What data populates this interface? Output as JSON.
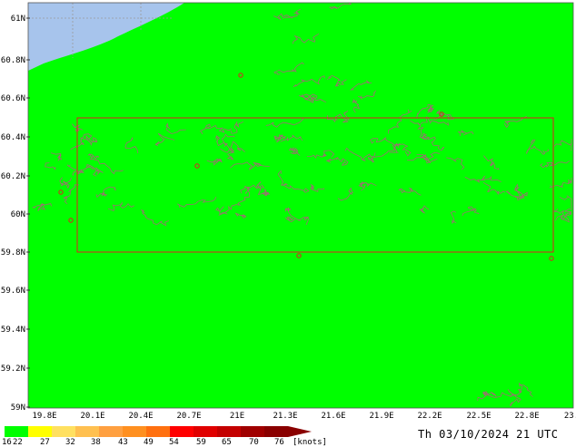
{
  "map": {
    "lat_labels": [
      "61N",
      "60.8N",
      "60.6N",
      "60.4N",
      "60.2N",
      "60N",
      "59.8N",
      "59.6N",
      "59.4N",
      "59.2N",
      "59N"
    ],
    "lon_labels": [
      "19.8E",
      "20.1E",
      "20.4E",
      "20.7E",
      "21E",
      "21.3E",
      "21.6E",
      "21.9E",
      "22.2E",
      "22.5E",
      "22.8E",
      "23."
    ],
    "colors": {
      "wind_field": "#00ff00",
      "land_masked": "#a7c4ec",
      "contour": "#9c7070",
      "box": "#e02020",
      "graticule": "#9a9a9a"
    }
  },
  "legend": {
    "values": [
      "16",
      "22",
      "27",
      "32",
      "38",
      "43",
      "49",
      "54",
      "59",
      "65",
      "70",
      "76"
    ],
    "unit": "[knots]",
    "colors": [
      "#00ff00",
      "#ffff00",
      "#ffe060",
      "#ffc050",
      "#ffa040",
      "#ff9020",
      "#ff7010",
      "#ff0000",
      "#e00000",
      "#c40000",
      "#a00000",
      "#8a0000"
    ]
  },
  "valid_time": "Th 03/10/2024 21 UTC"
}
